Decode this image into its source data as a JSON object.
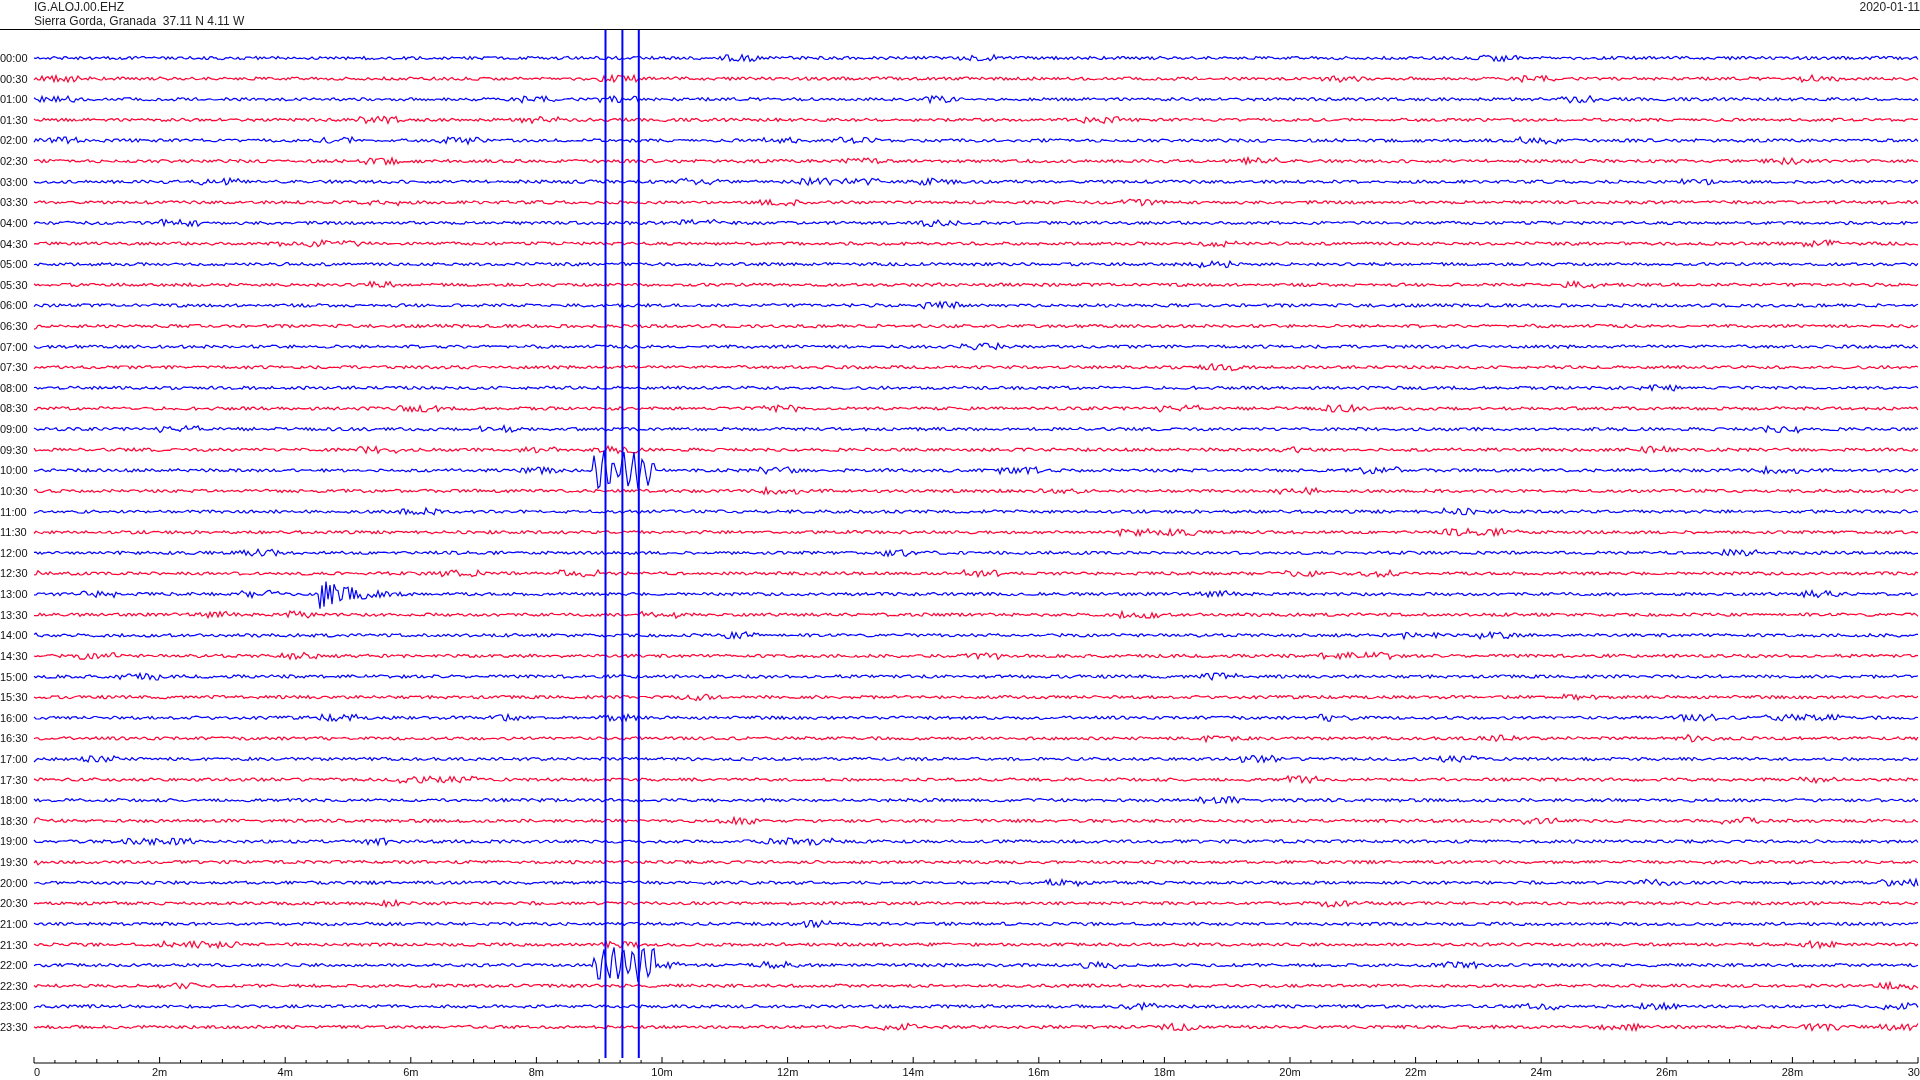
{
  "header": {
    "station": "IG.ALOJ.00.EHZ",
    "location": "Sierra Gorda, Granada  37.11 N 4.11 W",
    "date": "2020-01-11"
  },
  "traces": [
    {
      "label": "00:00",
      "color": "#0000ff"
    },
    {
      "label": "00:30",
      "color": "#ff0033"
    },
    {
      "label": "01:00",
      "color": "#0000ff"
    },
    {
      "label": "01:30",
      "color": "#ff0033"
    },
    {
      "label": "02:00",
      "color": "#0000ff"
    },
    {
      "label": "02:30",
      "color": "#ff0033"
    },
    {
      "label": "03:00",
      "color": "#0000ff"
    },
    {
      "label": "03:30",
      "color": "#ff0033"
    },
    {
      "label": "04:00",
      "color": "#0000ff"
    },
    {
      "label": "04:30",
      "color": "#ff0033"
    },
    {
      "label": "05:00",
      "color": "#0000ff"
    },
    {
      "label": "05:30",
      "color": "#ff0033"
    },
    {
      "label": "06:00",
      "color": "#0000ff"
    },
    {
      "label": "06:30",
      "color": "#ff0033"
    },
    {
      "label": "07:00",
      "color": "#0000ff"
    },
    {
      "label": "07:30",
      "color": "#ff0033"
    },
    {
      "label": "08:00",
      "color": "#0000ff"
    },
    {
      "label": "08:30",
      "color": "#ff0033"
    },
    {
      "label": "09:00",
      "color": "#0000ff"
    },
    {
      "label": "09:30",
      "color": "#ff0033"
    },
    {
      "label": "10:00",
      "color": "#0000ff"
    },
    {
      "label": "10:30",
      "color": "#ff0033"
    },
    {
      "label": "11:00",
      "color": "#0000ff"
    },
    {
      "label": "11:30",
      "color": "#ff0033"
    },
    {
      "label": "12:00",
      "color": "#0000ff"
    },
    {
      "label": "12:30",
      "color": "#ff0033"
    },
    {
      "label": "13:00",
      "color": "#0000ff"
    },
    {
      "label": "13:30",
      "color": "#ff0033"
    },
    {
      "label": "14:00",
      "color": "#0000ff"
    },
    {
      "label": "14:30",
      "color": "#ff0033"
    },
    {
      "label": "15:00",
      "color": "#0000ff"
    },
    {
      "label": "15:30",
      "color": "#ff0033"
    },
    {
      "label": "16:00",
      "color": "#0000ff"
    },
    {
      "label": "16:30",
      "color": "#ff0033"
    },
    {
      "label": "17:00",
      "color": "#0000ff"
    },
    {
      "label": "17:30",
      "color": "#ff0033"
    },
    {
      "label": "18:00",
      "color": "#0000ff"
    },
    {
      "label": "18:30",
      "color": "#ff0033"
    },
    {
      "label": "19:00",
      "color": "#0000ff"
    },
    {
      "label": "19:30",
      "color": "#ff0033"
    },
    {
      "label": "20:00",
      "color": "#0000ff"
    },
    {
      "label": "20:30",
      "color": "#ff0033"
    },
    {
      "label": "21:00",
      "color": "#0000ff"
    },
    {
      "label": "21:30",
      "color": "#ff0033"
    },
    {
      "label": "22:00",
      "color": "#0000ff"
    },
    {
      "label": "22:30",
      "color": "#ff0033"
    },
    {
      "label": "23:00",
      "color": "#0000ff"
    },
    {
      "label": "23:30",
      "color": "#ff0033"
    }
  ],
  "x_axis": {
    "tick_labels": [
      "0",
      "2m",
      "4m",
      "6m",
      "8m",
      "10m",
      "12m",
      "14m",
      "16m",
      "18m",
      "20m",
      "22m",
      "24m",
      "26m",
      "28m",
      "30"
    ]
  }
}
